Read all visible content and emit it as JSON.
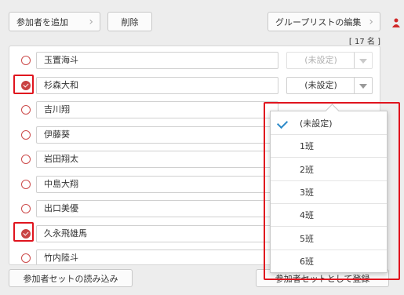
{
  "toolbar": {
    "add_label": "参加者を追加",
    "delete_label": "削除",
    "group_list_label": "グループリストの編集"
  },
  "count_label": "[ 17 名 ]",
  "participants": [
    {
      "name": "玉置海斗",
      "checked": false,
      "group": "(未設定)",
      "disabled": true
    },
    {
      "name": "杉森大和",
      "checked": true,
      "group": "(未設定)",
      "disabled": false
    },
    {
      "name": "吉川翔",
      "checked": false,
      "group": "",
      "disabled": false
    },
    {
      "name": "伊藤葵",
      "checked": false,
      "group": "",
      "disabled": false
    },
    {
      "name": "岩田翔太",
      "checked": false,
      "group": "",
      "disabled": false
    },
    {
      "name": "中島大翔",
      "checked": false,
      "group": "",
      "disabled": false
    },
    {
      "name": "出口美優",
      "checked": false,
      "group": "",
      "disabled": false
    },
    {
      "name": "久永飛雄馬",
      "checked": true,
      "group": "",
      "disabled": false
    },
    {
      "name": "竹内陸斗",
      "checked": false,
      "group": "",
      "disabled": false
    }
  ],
  "footer": {
    "load_label": "参加者セットの読み込み",
    "register_label": "参加者セットとして登録"
  },
  "dropdown": {
    "selected": "(未設定)",
    "options": [
      "(未設定)",
      "1班",
      "2班",
      "3班",
      "4班",
      "5班",
      "6班"
    ]
  },
  "colors": {
    "highlight": "#e0141e",
    "check_blue": "#2e8bc9",
    "radio_red": "#c94343"
  }
}
